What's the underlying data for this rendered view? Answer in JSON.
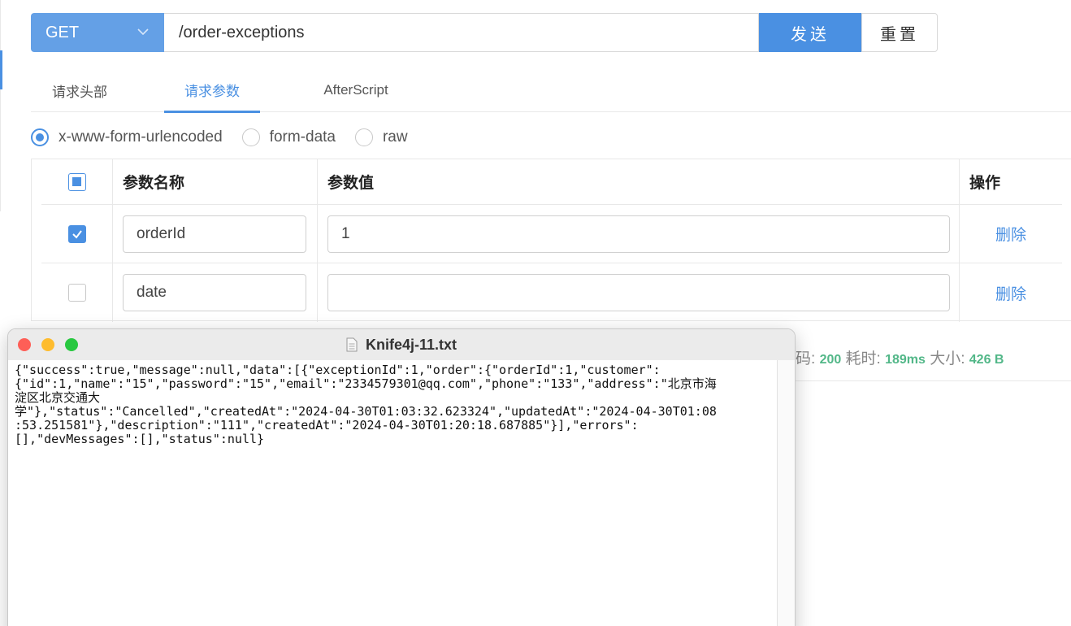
{
  "request": {
    "method": "GET",
    "url": "/order-exceptions",
    "send_label": "发送",
    "reset_label": "重置"
  },
  "tabs": [
    {
      "label": "请求头部",
      "active": false
    },
    {
      "label": "请求参数",
      "active": true
    },
    {
      "label": "AfterScript",
      "active": false
    }
  ],
  "body_types": [
    {
      "label": "x-www-form-urlencoded",
      "selected": true
    },
    {
      "label": "form-data",
      "selected": false
    },
    {
      "label": "raw",
      "selected": false
    }
  ],
  "params_table": {
    "headers": [
      "参数名称",
      "参数值",
      "操作"
    ],
    "rows": [
      {
        "checked": true,
        "name": "orderId",
        "value": "1",
        "action": "删除"
      },
      {
        "checked": false,
        "name": "date",
        "value": "",
        "action": "删除"
      }
    ]
  },
  "response_meta": {
    "code_label": "应码:",
    "code": "200",
    "time_label": "耗时:",
    "time": "189ms",
    "size_label": "大小:",
    "size": "426 B"
  },
  "text_window": {
    "title": "Knife4j-11.txt",
    "content": "{\"success\":true,\"message\":null,\"data\":[{\"exceptionId\":1,\"order\":{\"orderId\":1,\"customer\":\n{\"id\":1,\"name\":\"15\",\"password\":\"15\",\"email\":\"2334579301@qq.com\",\"phone\":\"133\",\"address\":\"北京市海\n淀区北京交通大\n学\"},\"status\":\"Cancelled\",\"createdAt\":\"2024-04-30T01:03:32.623324\",\"updatedAt\":\"2024-04-30T01:08\n:53.251581\"},\"description\":\"111\",\"createdAt\":\"2024-04-30T01:20:18.687885\"}],\"errors\":\n[],\"devMessages\":[],\"status\":null}"
  },
  "colors": {
    "accent": "#4a90e2",
    "success": "#52b788"
  }
}
